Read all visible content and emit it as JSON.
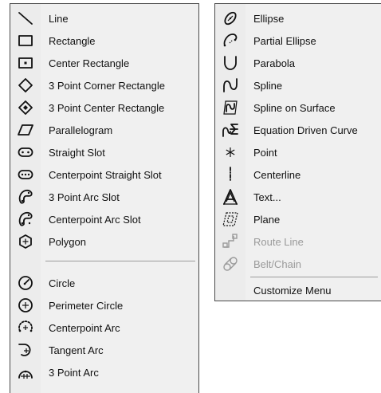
{
  "left_menu": {
    "group1": [
      {
        "label": "Line",
        "icon": "line-icon"
      },
      {
        "label": "Rectangle",
        "icon": "rectangle-icon"
      },
      {
        "label": "Center Rectangle",
        "icon": "center-rectangle-icon"
      },
      {
        "label": "3 Point Corner Rectangle",
        "icon": "3-point-corner-rectangle-icon"
      },
      {
        "label": "3 Point Center Rectangle",
        "icon": "3-point-center-rectangle-icon"
      },
      {
        "label": "Parallelogram",
        "icon": "parallelogram-icon"
      },
      {
        "label": "Straight Slot",
        "icon": "straight-slot-icon"
      },
      {
        "label": "Centerpoint Straight Slot",
        "icon": "centerpoint-straight-slot-icon"
      },
      {
        "label": "3 Point Arc Slot",
        "icon": "3-point-arc-slot-icon"
      },
      {
        "label": "Centerpoint Arc Slot",
        "icon": "centerpoint-arc-slot-icon"
      },
      {
        "label": "Polygon",
        "icon": "polygon-icon"
      }
    ],
    "group2": [
      {
        "label": "Circle",
        "icon": "circle-icon"
      },
      {
        "label": "Perimeter Circle",
        "icon": "perimeter-circle-icon"
      },
      {
        "label": "Centerpoint Arc",
        "icon": "centerpoint-arc-icon"
      },
      {
        "label": "Tangent Arc",
        "icon": "tangent-arc-icon"
      },
      {
        "label": "3 Point Arc",
        "icon": "3-point-arc-icon"
      }
    ]
  },
  "right_menu": {
    "items": [
      {
        "label": "Ellipse",
        "icon": "ellipse-icon",
        "enabled": true
      },
      {
        "label": "Partial Ellipse",
        "icon": "partial-ellipse-icon",
        "enabled": true
      },
      {
        "label": "Parabola",
        "icon": "parabola-icon",
        "enabled": true
      },
      {
        "label": "Spline",
        "icon": "spline-icon",
        "enabled": true
      },
      {
        "label": "Spline on Surface",
        "icon": "spline-on-surface-icon",
        "enabled": true
      },
      {
        "label": "Equation Driven Curve",
        "icon": "equation-driven-curve-icon",
        "enabled": true
      },
      {
        "label": "Point",
        "icon": "point-icon",
        "enabled": true
      },
      {
        "label": "Centerline",
        "icon": "centerline-icon",
        "enabled": true
      },
      {
        "label": "Text...",
        "icon": "text-icon",
        "enabled": true
      },
      {
        "label": "Plane",
        "icon": "plane-icon",
        "enabled": true
      },
      {
        "label": "Route Line",
        "icon": "route-line-icon",
        "enabled": false
      },
      {
        "label": "Belt/Chain",
        "icon": "belt-chain-icon",
        "enabled": false
      }
    ],
    "footer": {
      "label": "Customize Menu"
    }
  },
  "colors": {
    "menu_background": "#f0f0f0",
    "menu_border": "#4a4a4a",
    "separator": "#9c9c9c",
    "text": "#111111",
    "disabled_text": "#9a9a9a"
  }
}
